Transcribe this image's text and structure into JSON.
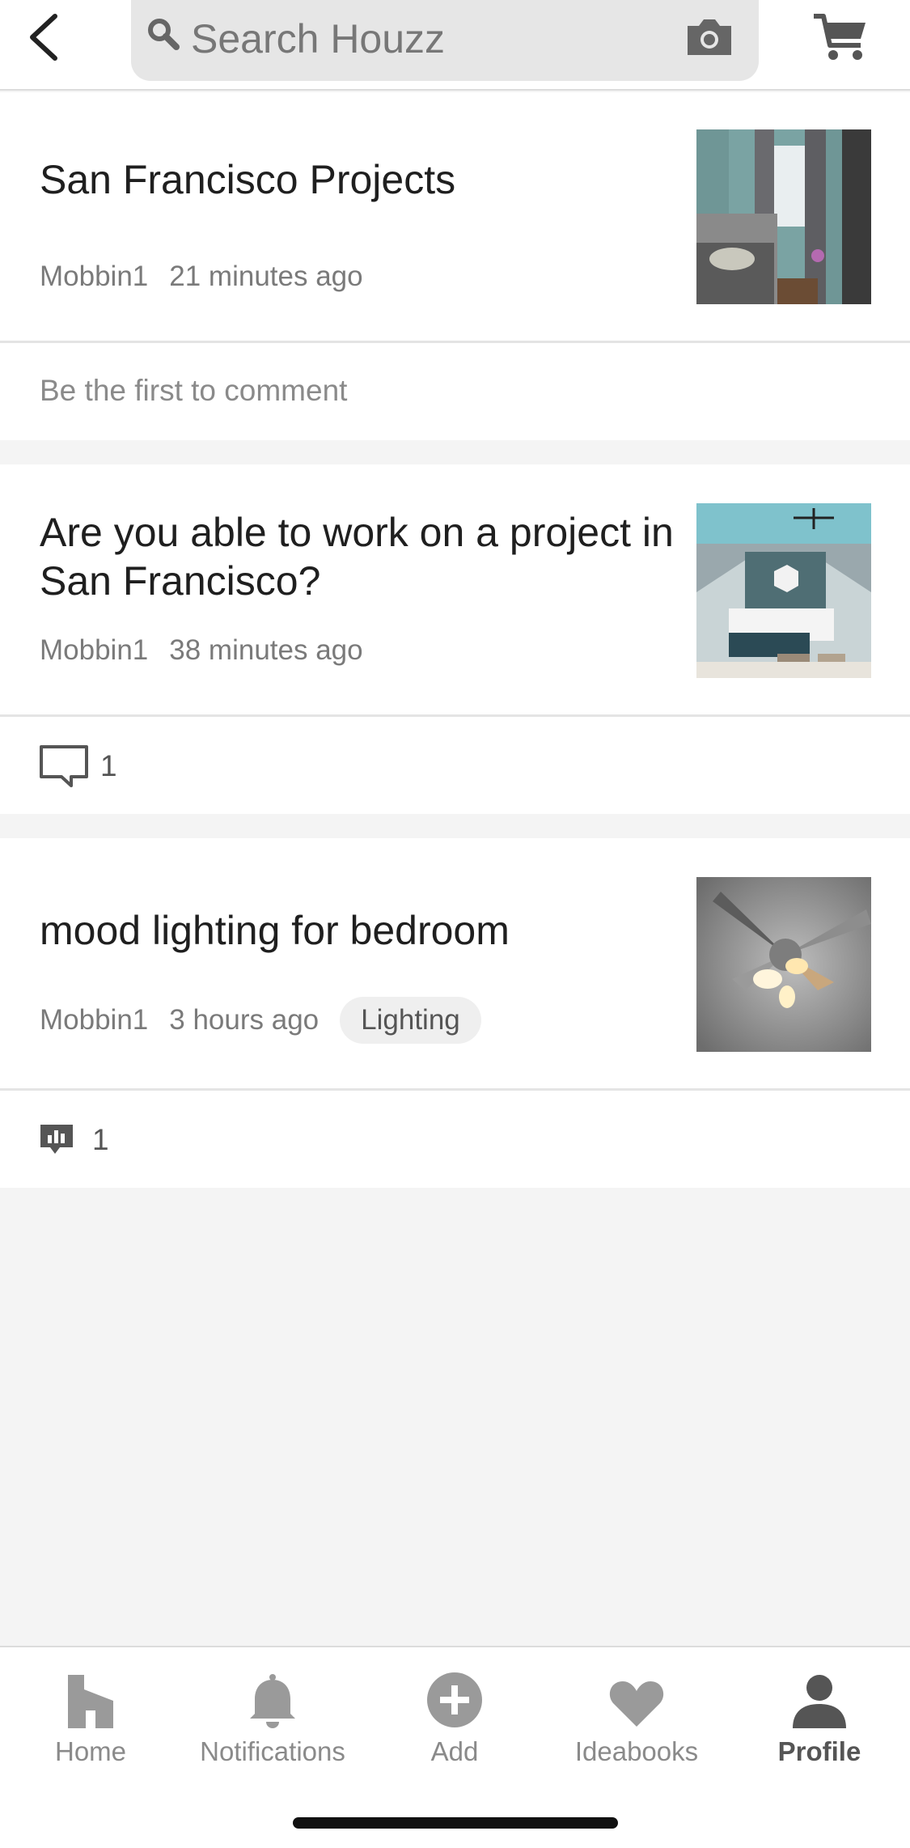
{
  "search": {
    "placeholder": "Search Houzz"
  },
  "posts": [
    {
      "title": "San Francisco Projects",
      "author": "Mobbin1",
      "time": "21 minutes ago",
      "tag": "",
      "footer_text": "Be the first to comment",
      "comment_count": ""
    },
    {
      "title": "Are you able to work on a project in San Francisco?",
      "author": "Mobbin1",
      "time": "38 minutes ago",
      "tag": "",
      "footer_text": "",
      "comment_count": "1"
    },
    {
      "title": "mood lighting for bedroom",
      "author": "Mobbin1",
      "time": "3 hours ago",
      "tag": "Lighting",
      "footer_text": "",
      "comment_count": "1"
    }
  ],
  "tabs": [
    {
      "label": "Home",
      "icon": "home-icon"
    },
    {
      "label": "Notifications",
      "icon": "bell-icon"
    },
    {
      "label": "Add",
      "icon": "plus-circle-icon"
    },
    {
      "label": "Ideabooks",
      "icon": "heart-icon"
    },
    {
      "label": "Profile",
      "icon": "person-icon"
    }
  ],
  "colors": {
    "accent": "#555555",
    "muted": "#8a8a8a",
    "background": "#f4f4f4"
  }
}
